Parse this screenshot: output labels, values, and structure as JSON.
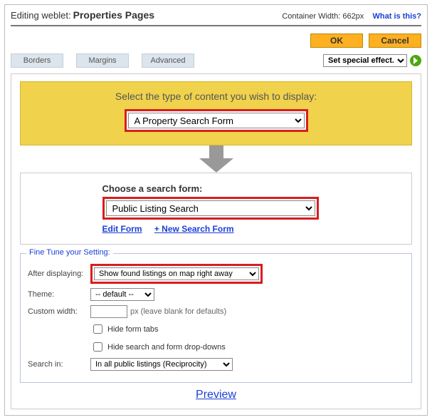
{
  "header": {
    "prefix": "Editing weblet:",
    "title": "Properties Pages",
    "container_label": "Container Width:",
    "container_value": "662px",
    "help_link": "What is this?"
  },
  "buttons": {
    "ok": "OK",
    "cancel": "Cancel"
  },
  "tabs": {
    "borders": "Borders",
    "margins": "Margins",
    "advanced": "Advanced"
  },
  "effect": {
    "placeholder": "Set special effect..."
  },
  "content_type": {
    "prompt": "Select the type of content you wish to display:",
    "selected": "A Property Search Form"
  },
  "search_form": {
    "label": "Choose a search form:",
    "selected": "Public Listing Search",
    "edit_link": "Edit Form",
    "new_link": "+ New Search Form"
  },
  "fine_tune": {
    "legend": "Fine Tune your Setting:",
    "after_label": "After displaying:",
    "after_value": "Show found listings on map right away",
    "theme_label": "Theme:",
    "theme_value": "-- default --",
    "width_label": "Custom width:",
    "width_value": "",
    "width_note": "px (leave blank for defaults)",
    "hide_tabs_label": "Hide form tabs",
    "hide_dd_label": "Hide search and form drop-downs",
    "search_in_label": "Search in:",
    "search_in_value": "In all public listings (Reciprocity)"
  },
  "preview": "Preview"
}
